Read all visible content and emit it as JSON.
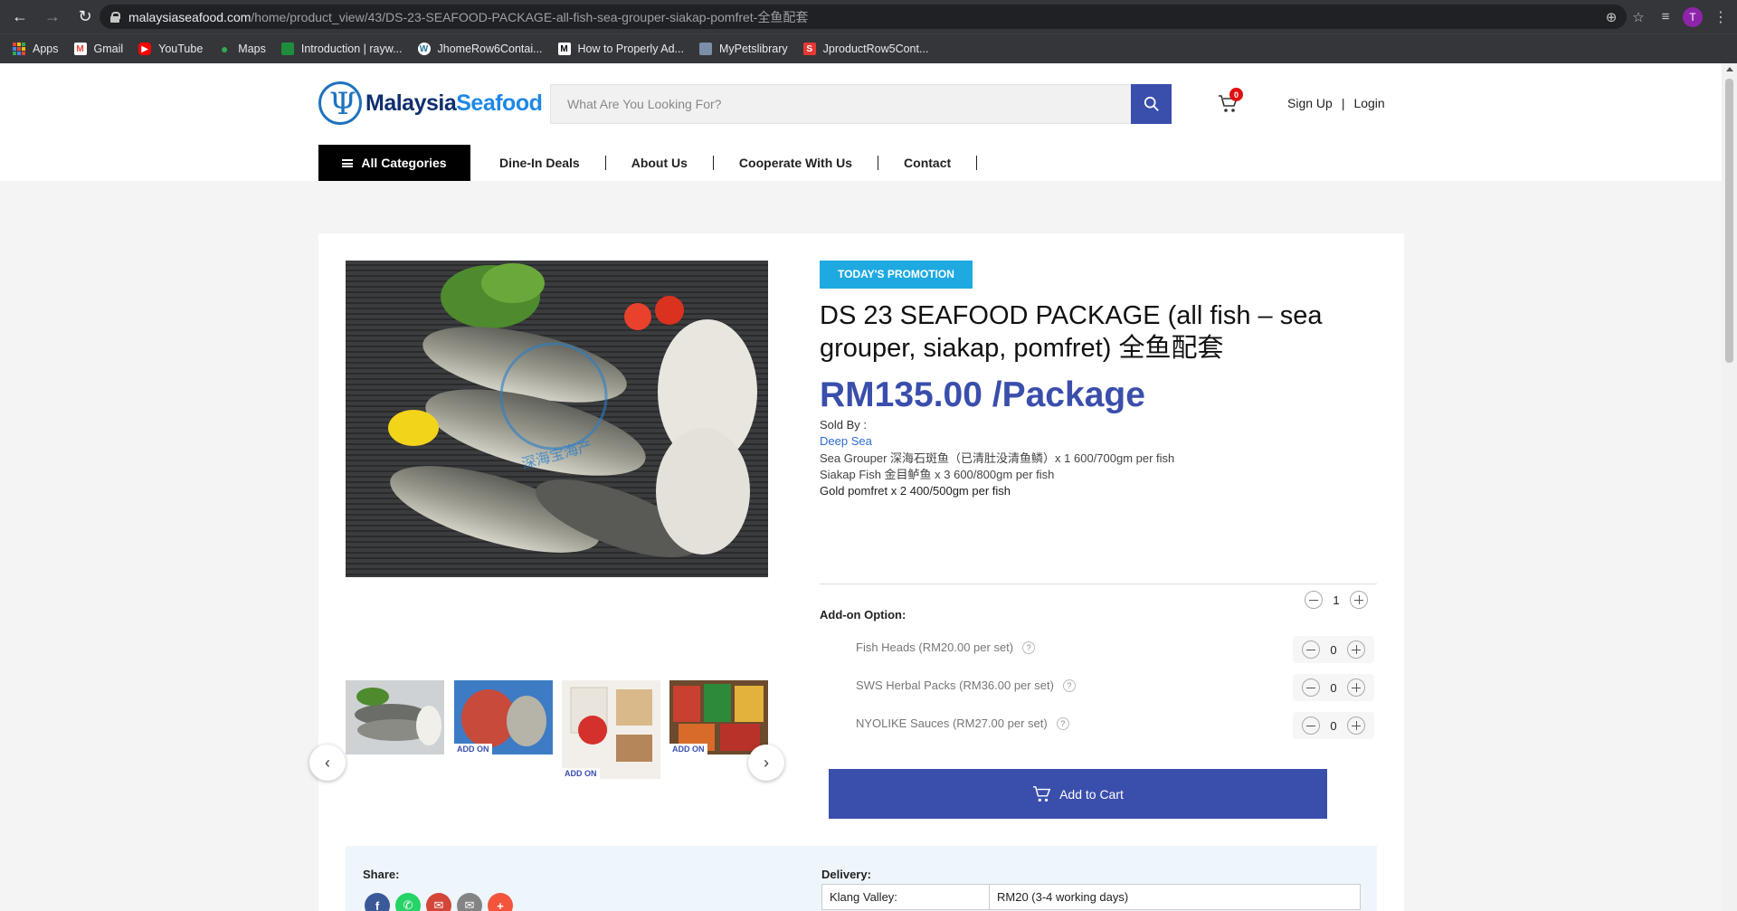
{
  "browser": {
    "url_host": "malaysiaseafood.com",
    "url_path": "/home/product_view/43/DS-23-SEAFOOD-PACKAGE-all-fish-sea-grouper-siakap-pomfret-全鱼配套",
    "profile_initial": "T",
    "bookmarks": [
      "Apps",
      "Gmail",
      "YouTube",
      "Maps",
      "Introduction | rayw...",
      "JhomeRow6Contai...",
      "How to Properly Ad...",
      "MyPetslibrary",
      "JproductRow5Cont..."
    ],
    "bookmark_letters": {
      "m": "M",
      "s": "S",
      "w": "W"
    }
  },
  "header": {
    "logo_part1": "Malaysia",
    "logo_part2": "Seafood",
    "search_placeholder": "What Are You Looking For?",
    "cart_count": "0",
    "signup": "Sign Up",
    "separator": "|",
    "login": "Login"
  },
  "menu": {
    "all_categories": "All Categories",
    "items": [
      "Dine-In Deals",
      "About Us",
      "Cooperate With Us",
      "Contact"
    ]
  },
  "product": {
    "promo_badge": "TODAY'S PROMOTION",
    "title": "DS 23 SEAFOOD PACKAGE (all fish – sea grouper, siakap, pomfret) 全鱼配套",
    "price": "RM135.00 /Package",
    "sold_by_label": "Sold By :",
    "seller": "Deep Sea",
    "description": [
      "Sea Grouper 深海石斑鱼（已清肚没清鱼鳞）x 1 600/700gm per fish",
      "Siakap Fish 金目鲈鱼 x 3 600/800gm per fish",
      "Gold pomfret x 2 400/500gm per fish"
    ],
    "quantity": "1",
    "watermark": "深海宝海产",
    "thumbnail_tag": "ADD ON"
  },
  "addons": {
    "title": "Add-on Option:",
    "help": "?",
    "items": [
      {
        "label": "Fish Heads (RM20.00 per set)",
        "qty": "0"
      },
      {
        "label": "SWS Herbal Packs (RM36.00 per set)",
        "qty": "0"
      },
      {
        "label": "NYOLIKE Sauces (RM27.00 per set)",
        "qty": "0"
      }
    ]
  },
  "cart_button": "Add to Cart",
  "share": {
    "title": "Share:",
    "icon_letters": {
      "facebook": "f",
      "plus": "+"
    }
  },
  "delivery": {
    "title": "Delivery:",
    "rows": [
      {
        "region": "Klang Valley:",
        "fee": "RM20 (3-4 working days)"
      }
    ]
  },
  "colors": {
    "brand_blue": "#3a4eac",
    "promo_cyan": "#1ea9e1",
    "link_blue": "#2f6bd3"
  }
}
